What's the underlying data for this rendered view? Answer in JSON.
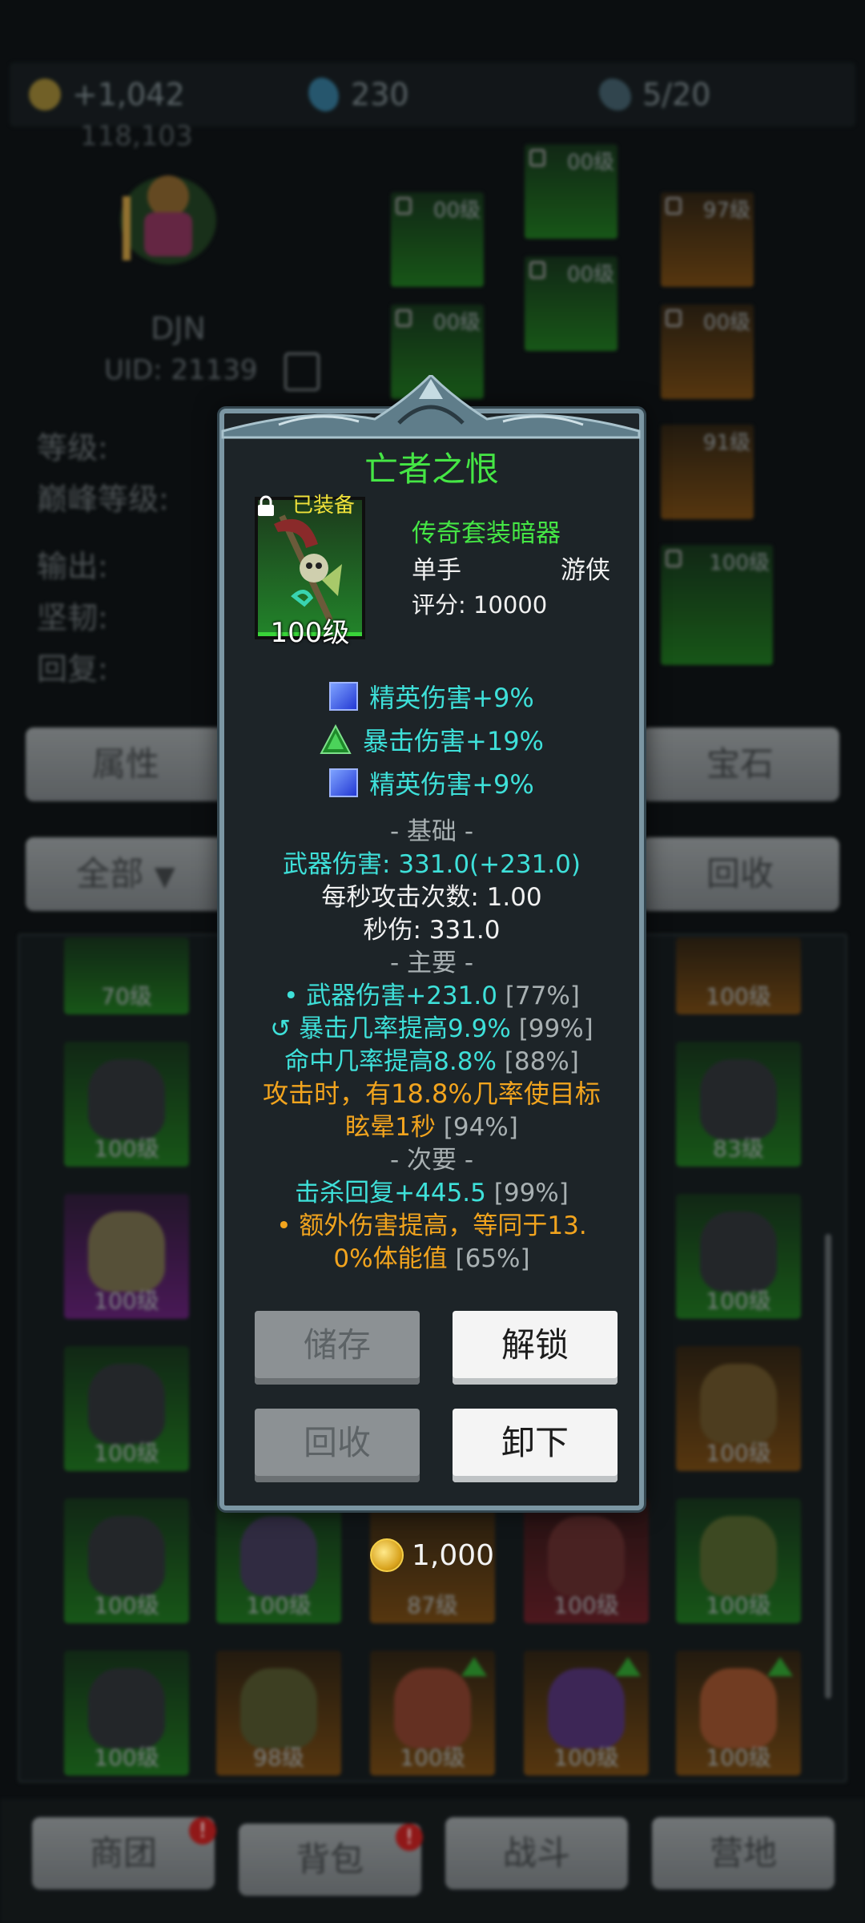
{
  "resources": {
    "gold": "+1,042",
    "gems": "230",
    "stamina": "5/20",
    "sub_value": "118,103"
  },
  "player": {
    "name": "DJN",
    "uid": "UID: 21139"
  },
  "stats_labels": [
    "等级:",
    "巅峰等级:",
    "输出:",
    "坚韧:",
    "回复:"
  ],
  "equip_slots": [
    {
      "level": "00级"
    },
    {
      "level": "00级"
    },
    {
      "level": "97级"
    },
    {
      "level": "00级"
    },
    {
      "level": "00级"
    },
    {
      "level": "00级"
    },
    {
      "level": "91级"
    },
    {
      "level": "100级"
    }
  ],
  "buttons": {
    "attributes": "属性",
    "gem": "宝石",
    "filter": "全部",
    "recycle_all": "回收"
  },
  "inventory_levels": [
    "70级",
    "100级",
    "100级",
    "83级",
    "100级",
    "100级",
    "100级",
    "100级",
    "100级",
    "100级",
    "87级",
    "100级",
    "100级",
    "100级",
    "98级",
    "100级",
    "100级",
    "100级"
  ],
  "bottom_tabs": [
    {
      "label": "商团",
      "badge": "!"
    },
    {
      "label": "背包",
      "badge": "!"
    },
    {
      "label": "战斗",
      "badge": ""
    },
    {
      "label": "营地",
      "badge": ""
    }
  ],
  "popup": {
    "item_name": "亡者之恨",
    "equipped_label": "已装备",
    "item_level": "100级",
    "rarity_type": "传奇套装暗器",
    "hand": "单手",
    "class": "游侠",
    "score": "评分: 10000",
    "gem_affixes": [
      {
        "text": "精英伤害+9%",
        "gem": "blue-square"
      },
      {
        "text": "暴击伤害+19%",
        "gem": "green-triangle"
      },
      {
        "text": "精英伤害+9%",
        "gem": "blue-square"
      }
    ],
    "section_base": "- 基础 -",
    "weapon_damage": "武器伤害: 331.0(+231.0)",
    "attack_speed": "每秒攻击次数: 1.00",
    "dps": "秒伤: 331.0",
    "section_main": "- 主要 -",
    "main_affixes": [
      {
        "text": "• 武器伤害+231.0",
        "pct": "[77%]"
      },
      {
        "text": "暴击几率提高9.9%",
        "pct": "[99%]"
      },
      {
        "text": "命中几率提高8.8%",
        "pct": "[88%]"
      }
    ],
    "proc_line1": "攻击时，有18.8%几率使目标",
    "proc_line2": "眩晕1秒",
    "proc_pct": "[94%]",
    "section_secondary": "- 次要 -",
    "kill_heal": "击杀回复+445.5",
    "kill_heal_pct": "[99%]",
    "extra_line1": "• 额外伤害提高，等同于13.",
    "extra_line2": "0%体能值",
    "extra_pct": "[65%]",
    "btn_store": "储存",
    "btn_unlock": "解锁",
    "btn_recycle": "回收",
    "btn_unequip": "卸下"
  },
  "price": "1,000",
  "colors": {
    "legendary_green": "#45e645",
    "affix_cyan": "#3ee0d9",
    "proc_orange": "#f2a41e",
    "equipped_yellow": "#f0e23a"
  }
}
